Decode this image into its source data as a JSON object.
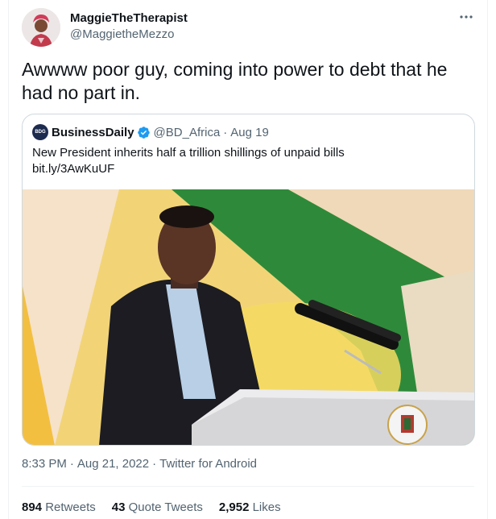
{
  "tweet": {
    "author": {
      "display_name": "MaggieTheTherapist",
      "handle": "@MaggietheMezzo"
    },
    "more_icon": "more-horizontal-icon",
    "text": "Awwww poor guy, coming into power to debt that he had no part in.",
    "quoted": {
      "avatar_text": "BDG",
      "display_name": "BusinessDaily",
      "verified": true,
      "handle": "@BD_Africa",
      "separator": "·",
      "date": "Aug 19",
      "text_line1": "New President inherits half a trillion shillings of unpaid bills",
      "text_line2": "bit.ly/3AwKuUF"
    },
    "meta": {
      "time": "8:33 PM",
      "separator": "·",
      "date": "Aug 21, 2022",
      "source": "Twitter for Android"
    },
    "stats": {
      "retweets_count": "894",
      "retweets_label": "Retweets",
      "quotes_count": "43",
      "quotes_label": "Quote Tweets",
      "likes_count": "2,952",
      "likes_label": "Likes"
    }
  },
  "colors": {
    "text_primary": "#0f1419",
    "text_secondary": "#536471",
    "verified_blue": "#1d9bf0",
    "border": "#cfd9de"
  }
}
